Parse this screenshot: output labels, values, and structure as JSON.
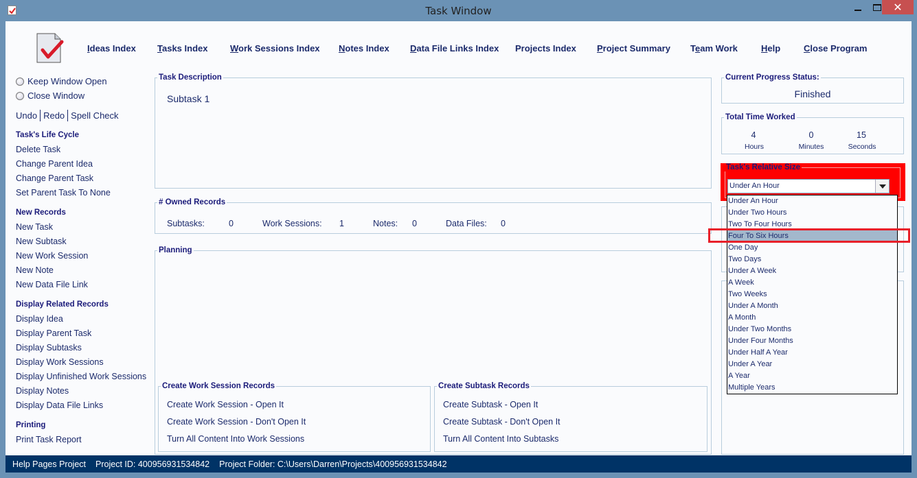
{
  "window": {
    "title": "Task Window",
    "controls": {
      "minimize": "–",
      "maximize": "☐",
      "close": "✕"
    }
  },
  "nav": [
    {
      "label": "Ideas Index",
      "mnemonic": "I"
    },
    {
      "label": "Tasks Index",
      "mnemonic": "T"
    },
    {
      "label": "Work Sessions Index",
      "mnemonic": "W"
    },
    {
      "label": "Notes Index",
      "mnemonic": "N"
    },
    {
      "label": "Data File Links Index",
      "mnemonic": "D"
    },
    {
      "label": "Projects Index",
      "mnemonic": ""
    },
    {
      "label": "Project Summary",
      "mnemonic": "P"
    },
    {
      "label": "Team Work",
      "mnemonic": "e"
    },
    {
      "label": "Help",
      "mnemonic": "H"
    },
    {
      "label": "Close Program",
      "mnemonic": "C"
    }
  ],
  "sidebar": {
    "radios": [
      {
        "label": "Keep Window Open",
        "checked": false
      },
      {
        "label": "Close Window",
        "checked": false
      }
    ],
    "edit": [
      "Undo",
      "Redo",
      "Spell Check"
    ],
    "sections": [
      {
        "heading": "Task's Life Cycle",
        "items": [
          "Delete Task",
          "Change Parent Idea",
          "Change Parent Task",
          "Set Parent Task To None"
        ]
      },
      {
        "heading": "New Records",
        "items": [
          "New Task",
          "New Subtask",
          "New Work Session",
          "New Note",
          "New Data File Link"
        ]
      },
      {
        "heading": "Display Related Records",
        "items": [
          "Display Idea",
          "Display Parent Task",
          "Display Subtasks",
          "Display Work Sessions",
          "Display Unfinished Work Sessions",
          "Display Notes",
          "Display Data File Links"
        ]
      },
      {
        "heading": "Printing",
        "items": [
          "Print Task Report"
        ]
      }
    ]
  },
  "main": {
    "description": {
      "legend": "Task Description",
      "text": "Subtask 1"
    },
    "owned": {
      "legend": "# Owned Records",
      "items": [
        {
          "label": "Subtasks:",
          "value": "0"
        },
        {
          "label": "Work Sessions:",
          "value": "1"
        },
        {
          "label": "Notes:",
          "value": "0"
        },
        {
          "label": "Data Files:",
          "value": "0"
        }
      ]
    },
    "planning": {
      "legend": "Planning"
    },
    "work_session_records": {
      "legend": "Create Work Session Records",
      "actions": [
        "Create Work Session - Open It",
        "Create Work Session - Don't Open It",
        "Turn All Content Into Work Sessions"
      ]
    },
    "subtask_records": {
      "legend": "Create Subtask Records",
      "actions": [
        "Create Subtask - Open It",
        "Create Subtask - Don't Open It",
        "Turn All Content Into Subtasks"
      ]
    }
  },
  "right": {
    "status": {
      "legend": "Current Progress Status:",
      "value": "Finished"
    },
    "time": {
      "legend": "Total Time Worked",
      "hours": "4",
      "hours_label": "Hours",
      "minutes": "0",
      "minutes_label": "Minutes",
      "seconds": "15",
      "seconds_label": "Seconds"
    },
    "size": {
      "legend": "Task's Relative Size",
      "selected": "Under An Hour",
      "highlighted": "Four To Six Hours",
      "options": [
        "Under An Hour",
        "Under Two Hours",
        "Two To Four Hours",
        "Four To Six Hours",
        "One Day",
        "Two Days",
        "Under A Week",
        "A Week",
        "Two Weeks",
        "Under A Month",
        "A Month",
        "Under Two Months",
        "Under Four Months",
        "Under Half A Year",
        "Under A Year",
        "A Year",
        "Multiple Years"
      ]
    }
  },
  "statusbar": {
    "project_name": "Help Pages Project",
    "project_id": "Project ID:  400956931534842",
    "project_folder": "Project Folder: C:\\Users\\Darren\\Projects\\400956931534842"
  },
  "colors": {
    "title_bar": "#6b92b5",
    "status_bar": "#003366",
    "highlight_red": "#ff0000",
    "text": "#1b2a6b",
    "heading": "#1b1b7a",
    "selected_option": "#a3b8cc"
  }
}
